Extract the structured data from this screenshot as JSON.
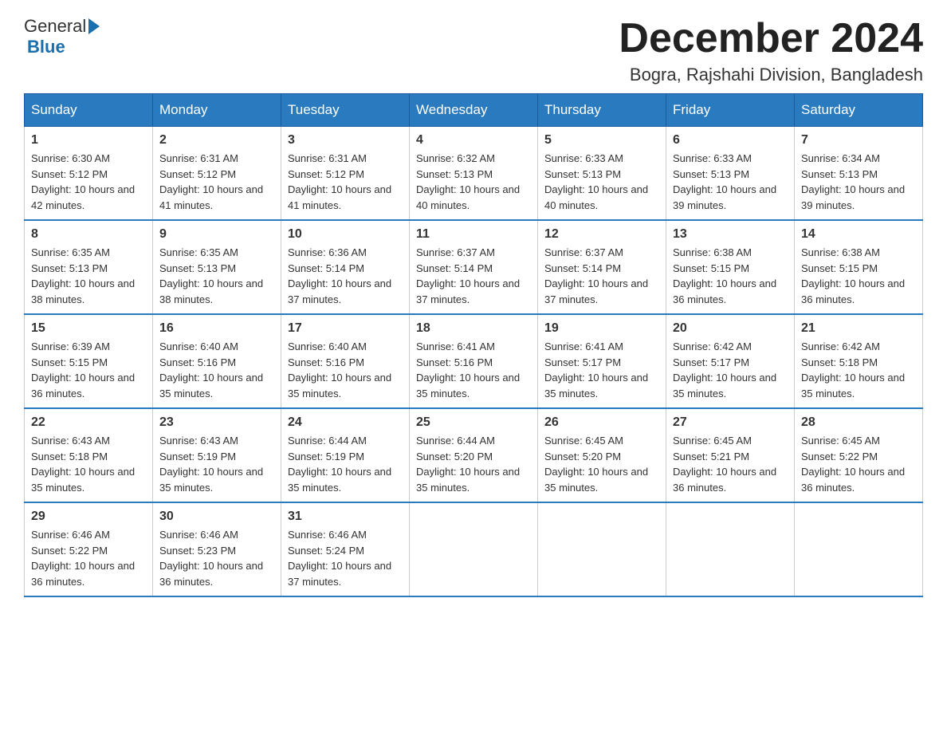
{
  "header": {
    "logo_text_general": "General",
    "logo_text_blue": "Blue",
    "month_year": "December 2024",
    "location": "Bogra, Rajshahi Division, Bangladesh"
  },
  "days_of_week": [
    "Sunday",
    "Monday",
    "Tuesday",
    "Wednesday",
    "Thursday",
    "Friday",
    "Saturday"
  ],
  "weeks": [
    [
      {
        "day": "1",
        "sunrise": "6:30 AM",
        "sunset": "5:12 PM",
        "daylight": "10 hours and 42 minutes."
      },
      {
        "day": "2",
        "sunrise": "6:31 AM",
        "sunset": "5:12 PM",
        "daylight": "10 hours and 41 minutes."
      },
      {
        "day": "3",
        "sunrise": "6:31 AM",
        "sunset": "5:12 PM",
        "daylight": "10 hours and 41 minutes."
      },
      {
        "day": "4",
        "sunrise": "6:32 AM",
        "sunset": "5:13 PM",
        "daylight": "10 hours and 40 minutes."
      },
      {
        "day": "5",
        "sunrise": "6:33 AM",
        "sunset": "5:13 PM",
        "daylight": "10 hours and 40 minutes."
      },
      {
        "day": "6",
        "sunrise": "6:33 AM",
        "sunset": "5:13 PM",
        "daylight": "10 hours and 39 minutes."
      },
      {
        "day": "7",
        "sunrise": "6:34 AM",
        "sunset": "5:13 PM",
        "daylight": "10 hours and 39 minutes."
      }
    ],
    [
      {
        "day": "8",
        "sunrise": "6:35 AM",
        "sunset": "5:13 PM",
        "daylight": "10 hours and 38 minutes."
      },
      {
        "day": "9",
        "sunrise": "6:35 AM",
        "sunset": "5:13 PM",
        "daylight": "10 hours and 38 minutes."
      },
      {
        "day": "10",
        "sunrise": "6:36 AM",
        "sunset": "5:14 PM",
        "daylight": "10 hours and 37 minutes."
      },
      {
        "day": "11",
        "sunrise": "6:37 AM",
        "sunset": "5:14 PM",
        "daylight": "10 hours and 37 minutes."
      },
      {
        "day": "12",
        "sunrise": "6:37 AM",
        "sunset": "5:14 PM",
        "daylight": "10 hours and 37 minutes."
      },
      {
        "day": "13",
        "sunrise": "6:38 AM",
        "sunset": "5:15 PM",
        "daylight": "10 hours and 36 minutes."
      },
      {
        "day": "14",
        "sunrise": "6:38 AM",
        "sunset": "5:15 PM",
        "daylight": "10 hours and 36 minutes."
      }
    ],
    [
      {
        "day": "15",
        "sunrise": "6:39 AM",
        "sunset": "5:15 PM",
        "daylight": "10 hours and 36 minutes."
      },
      {
        "day": "16",
        "sunrise": "6:40 AM",
        "sunset": "5:16 PM",
        "daylight": "10 hours and 35 minutes."
      },
      {
        "day": "17",
        "sunrise": "6:40 AM",
        "sunset": "5:16 PM",
        "daylight": "10 hours and 35 minutes."
      },
      {
        "day": "18",
        "sunrise": "6:41 AM",
        "sunset": "5:16 PM",
        "daylight": "10 hours and 35 minutes."
      },
      {
        "day": "19",
        "sunrise": "6:41 AM",
        "sunset": "5:17 PM",
        "daylight": "10 hours and 35 minutes."
      },
      {
        "day": "20",
        "sunrise": "6:42 AM",
        "sunset": "5:17 PM",
        "daylight": "10 hours and 35 minutes."
      },
      {
        "day": "21",
        "sunrise": "6:42 AM",
        "sunset": "5:18 PM",
        "daylight": "10 hours and 35 minutes."
      }
    ],
    [
      {
        "day": "22",
        "sunrise": "6:43 AM",
        "sunset": "5:18 PM",
        "daylight": "10 hours and 35 minutes."
      },
      {
        "day": "23",
        "sunrise": "6:43 AM",
        "sunset": "5:19 PM",
        "daylight": "10 hours and 35 minutes."
      },
      {
        "day": "24",
        "sunrise": "6:44 AM",
        "sunset": "5:19 PM",
        "daylight": "10 hours and 35 minutes."
      },
      {
        "day": "25",
        "sunrise": "6:44 AM",
        "sunset": "5:20 PM",
        "daylight": "10 hours and 35 minutes."
      },
      {
        "day": "26",
        "sunrise": "6:45 AM",
        "sunset": "5:20 PM",
        "daylight": "10 hours and 35 minutes."
      },
      {
        "day": "27",
        "sunrise": "6:45 AM",
        "sunset": "5:21 PM",
        "daylight": "10 hours and 36 minutes."
      },
      {
        "day": "28",
        "sunrise": "6:45 AM",
        "sunset": "5:22 PM",
        "daylight": "10 hours and 36 minutes."
      }
    ],
    [
      {
        "day": "29",
        "sunrise": "6:46 AM",
        "sunset": "5:22 PM",
        "daylight": "10 hours and 36 minutes."
      },
      {
        "day": "30",
        "sunrise": "6:46 AM",
        "sunset": "5:23 PM",
        "daylight": "10 hours and 36 minutes."
      },
      {
        "day": "31",
        "sunrise": "6:46 AM",
        "sunset": "5:24 PM",
        "daylight": "10 hours and 37 minutes."
      },
      null,
      null,
      null,
      null
    ]
  ]
}
